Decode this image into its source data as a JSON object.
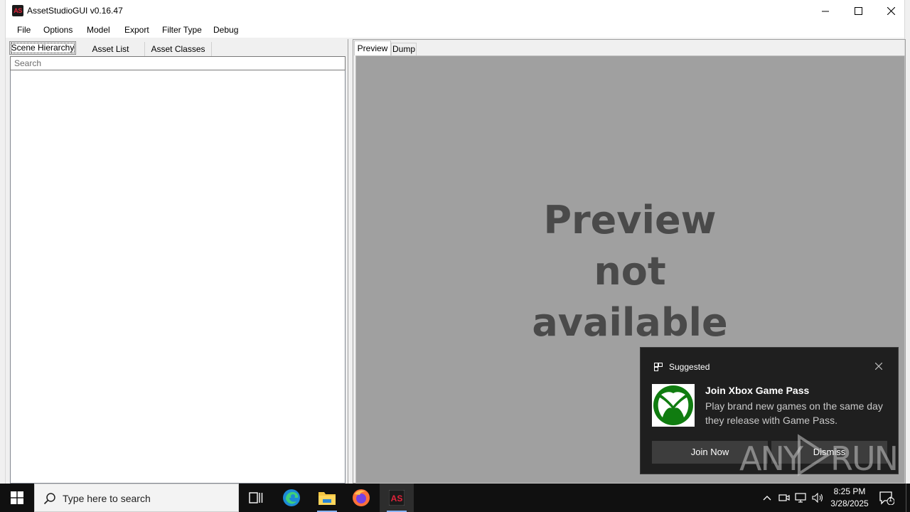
{
  "window": {
    "title": "AssetStudioGUI v0.16.47",
    "icon_text": "AS"
  },
  "menu": {
    "items": [
      "File",
      "Options",
      "Model",
      "Export",
      "Filter Type",
      "Debug"
    ]
  },
  "left_panel": {
    "tabs": [
      "Scene Hierarchy",
      "Asset List",
      "Asset Classes"
    ],
    "search_placeholder": "Search"
  },
  "right_panel": {
    "tabs": [
      "Preview",
      "Dump"
    ],
    "preview_message_lines": [
      "Preview",
      "not",
      "available"
    ]
  },
  "toast": {
    "app_name": "Suggested",
    "title": "Join Xbox Game Pass",
    "body": "Play brand new games on the same day they release with Game Pass.",
    "primary_button": "Join Now",
    "secondary_button": "Dismiss",
    "image_icon": "xbox-logo-icon",
    "accent_color": "#107c10"
  },
  "watermark": {
    "left": "ANY",
    "right": "RUN"
  },
  "taskbar": {
    "search_placeholder": "Type here to search",
    "clock_time": "8:25 PM",
    "clock_date": "3/28/2025",
    "notification_count": "1",
    "pinned_icons": [
      "task-view-icon",
      "edge-icon",
      "file-explorer-icon",
      "firefox-icon",
      "assetstudio-icon"
    ]
  }
}
